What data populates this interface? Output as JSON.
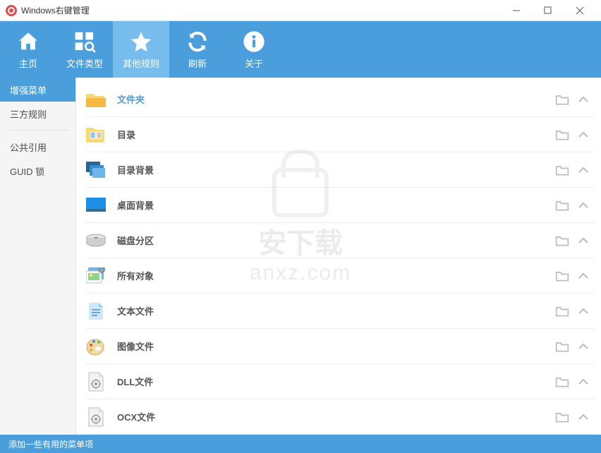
{
  "window": {
    "title": "Windows右键管理"
  },
  "toolbar": [
    {
      "id": "home",
      "label": "主页"
    },
    {
      "id": "filetype",
      "label": "文件类型"
    },
    {
      "id": "rules",
      "label": "其他规则",
      "active": true
    },
    {
      "id": "refresh",
      "label": "刷新"
    },
    {
      "id": "about",
      "label": "关于"
    }
  ],
  "sidebar": {
    "group1": [
      {
        "id": "enhance",
        "label": "增强菜单",
        "active": true
      },
      {
        "id": "third",
        "label": "三方规则"
      }
    ],
    "group2": [
      {
        "id": "pubref",
        "label": "公共引用"
      },
      {
        "id": "guid",
        "label": "GUID 锁"
      }
    ]
  },
  "items": [
    {
      "label": "文件夹",
      "icon": "folder-yellow",
      "selected": true
    },
    {
      "label": "目录",
      "icon": "folder-thumb"
    },
    {
      "label": "目录背景",
      "icon": "cascade"
    },
    {
      "label": "桌面背景",
      "icon": "desktop-blue"
    },
    {
      "label": "磁盘分区",
      "icon": "disk"
    },
    {
      "label": "所有对象",
      "icon": "gallery"
    },
    {
      "label": "文本文件",
      "icon": "textfile"
    },
    {
      "label": "图像文件",
      "icon": "palette"
    },
    {
      "label": "DLL文件",
      "icon": "gear-doc"
    },
    {
      "label": "OCX文件",
      "icon": "gear-doc"
    }
  ],
  "status": "添加一些有用的菜单项",
  "watermark": {
    "line1": "安下载",
    "line2": "anxz.com"
  }
}
